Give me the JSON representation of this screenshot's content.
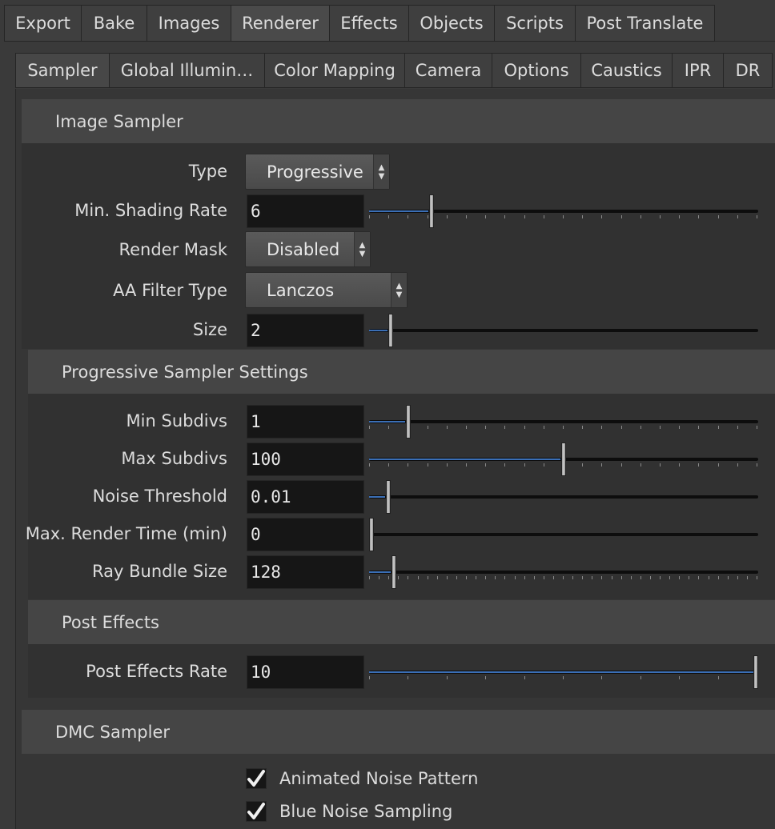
{
  "top_tabs": [
    "Export",
    "Bake",
    "Images",
    "Renderer",
    "Effects",
    "Objects",
    "Scripts",
    "Post Translate"
  ],
  "top_tab_active": "Renderer",
  "sub_tabs": [
    "Sampler",
    "Global Illumin…",
    "Color Mapping",
    "Camera",
    "Options",
    "Caustics",
    "IPR",
    "DR"
  ],
  "sub_tab_active": "Sampler",
  "image_sampler": {
    "title": "Image Sampler",
    "type_label": "Type",
    "type_value": "Progressive",
    "min_shading_rate_label": "Min. Shading Rate",
    "min_shading_rate_value": "6",
    "min_shading_rate_fraction": 0.16,
    "render_mask_label": "Render Mask",
    "render_mask_value": "Disabled",
    "aa_filter_type_label": "AA Filter Type",
    "aa_filter_type_value": "Lanczos",
    "size_label": "Size",
    "size_value": "2",
    "size_fraction": 0.055
  },
  "progressive_sampler": {
    "title": "Progressive Sampler Settings",
    "min_subdivs_label": "Min Subdivs",
    "min_subdivs_value": "1",
    "min_subdivs_fraction": 0.1,
    "max_subdivs_label": "Max Subdivs",
    "max_subdivs_value": "100",
    "max_subdivs_fraction": 0.5,
    "noise_threshold_label": "Noise Threshold",
    "noise_threshold_value": "0.01",
    "noise_threshold_fraction": 0.05,
    "max_render_time_label": "Max. Render Time (min)",
    "max_render_time_value": "0",
    "max_render_time_fraction": 0.0,
    "ray_bundle_size_label": "Ray Bundle Size",
    "ray_bundle_size_value": "128",
    "ray_bundle_size_fraction": 0.064
  },
  "post_effects": {
    "title": "Post Effects",
    "rate_label": "Post Effects Rate",
    "rate_value": "10",
    "rate_fraction": 1.0
  },
  "dmc_sampler": {
    "title": "DMC Sampler",
    "animated_noise_label": "Animated Noise Pattern",
    "animated_noise_checked": true,
    "blue_noise_label": "Blue Noise Sampling",
    "blue_noise_checked": true
  },
  "colors": {
    "slider_fill": "#3b6fb6",
    "background": "#3a3a3a"
  }
}
